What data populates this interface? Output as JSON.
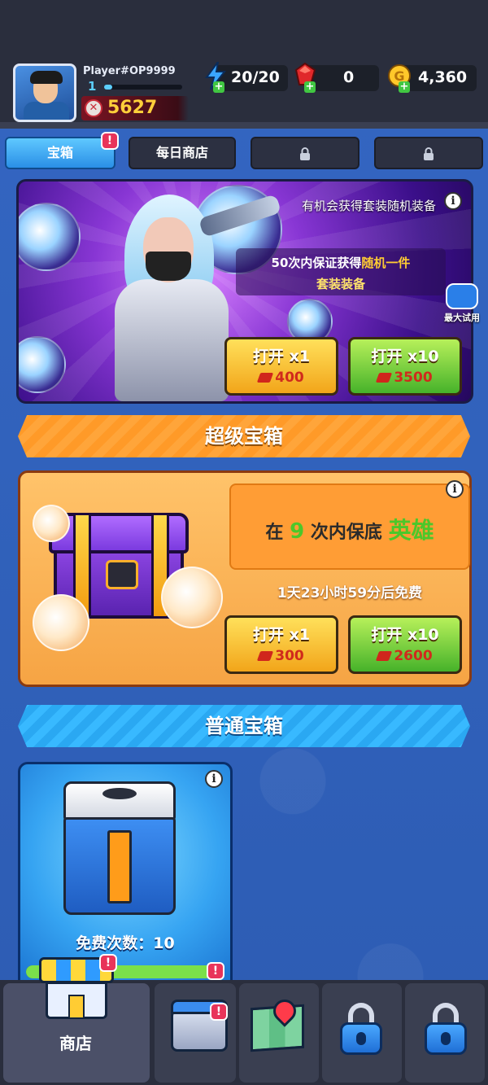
{
  "header": {
    "player_name": "Player#OP9999",
    "level": "1",
    "xp_progress": 0.1,
    "power": "5627",
    "resources": {
      "energy": "20/20",
      "gems": "0",
      "coins": "4,360"
    }
  },
  "tabs": [
    {
      "label": "宝箱",
      "active": true,
      "badge": "!"
    },
    {
      "label": "每日商店",
      "active": false
    },
    {
      "label": "",
      "locked": true
    },
    {
      "label": "",
      "locked": true
    }
  ],
  "banner": {
    "top_text": "有机会获得套装随机装备",
    "guarantee_prefix": "50次内保证获得",
    "guarantee_highlight": "随机一件",
    "guarantee_line2": "套装装备",
    "try_label": "最大试用",
    "open_x1": {
      "label": "打开 x1",
      "price": "400"
    },
    "open_x10": {
      "label": "打开 x10",
      "price": "3500"
    }
  },
  "super_chest": {
    "header": "超级宝箱",
    "guarantee_pre": "在",
    "guarantee_num": "9",
    "guarantee_mid": "次内保底",
    "guarantee_hero": "英雄",
    "timer": "1天23小时59分后免费",
    "open_x1": {
      "label": "打开 x1",
      "price": "300"
    },
    "open_x10": {
      "label": "打开 x10",
      "price": "2600"
    }
  },
  "basic_chest": {
    "header": "普通宝箱",
    "free_count": "免费次数：10",
    "badge": "!"
  },
  "bottom_nav": {
    "shop_label": "商店",
    "shop_badge": "!",
    "inventory_badge": "!"
  },
  "colors": {
    "accent_blue": "#2a8fe6",
    "gold_yellow": "#ffcc33",
    "gem_red": "#d0261c",
    "green_highlight": "#4cc72a",
    "badge_pink": "#e8345a"
  }
}
